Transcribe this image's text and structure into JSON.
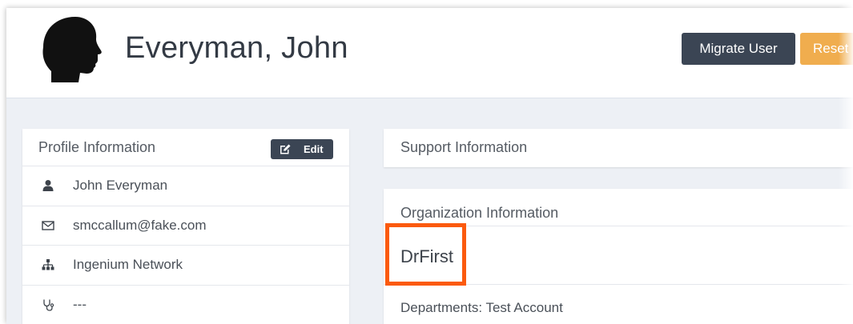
{
  "header": {
    "user_name": "Everyman, John",
    "migrate_button": "Migrate User",
    "reset_button": "Reset"
  },
  "profile": {
    "title": "Profile Information",
    "edit_label": "Edit",
    "rows": [
      {
        "icon": "user-icon",
        "text": "John Everyman"
      },
      {
        "icon": "envelope-icon",
        "text": "smccallum@fake.com"
      },
      {
        "icon": "sitemap-icon",
        "text": "Ingenium Network"
      },
      {
        "icon": "stethoscope-icon",
        "text": "---"
      }
    ]
  },
  "support": {
    "title": "Support Information"
  },
  "organization": {
    "title": "Organization Information",
    "name": "DrFirst",
    "departments": "Departments: Test Account"
  },
  "colors": {
    "dark_button": "#3b4554",
    "reset_button": "#f0ad4e",
    "highlight": "#fb5a0e",
    "background": "#edf0f5"
  }
}
